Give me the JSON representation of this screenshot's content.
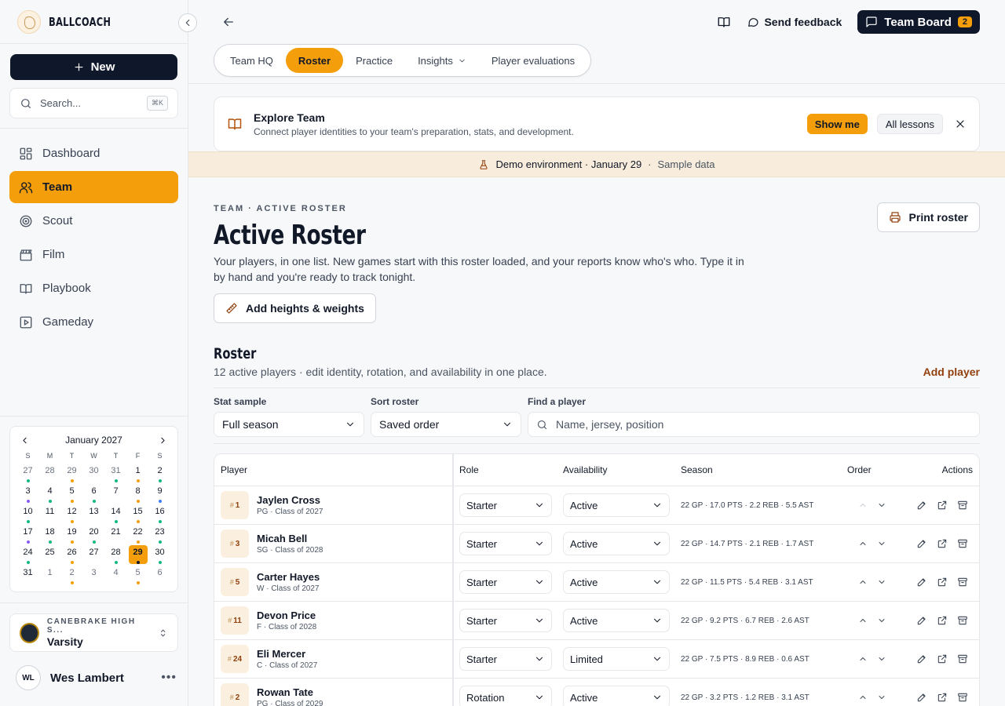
{
  "brand": {
    "name": "BALLCOACH"
  },
  "sidebar": {
    "new_label": "New",
    "search_placeholder": "Search...",
    "search_shortcut": "⌘K",
    "nav": [
      {
        "label": "Dashboard",
        "icon": "grid-icon"
      },
      {
        "label": "Team",
        "icon": "users-icon"
      },
      {
        "label": "Scout",
        "icon": "target-icon"
      },
      {
        "label": "Film",
        "icon": "clapper-icon"
      },
      {
        "label": "Playbook",
        "icon": "book-icon"
      },
      {
        "label": "Gameday",
        "icon": "play-icon"
      }
    ],
    "active_nav": "Team"
  },
  "calendar": {
    "month": "January 2027",
    "weekdays": [
      "S",
      "M",
      "T",
      "W",
      "T",
      "F",
      "S"
    ],
    "days": [
      {
        "d": "27",
        "muted": true,
        "dot": "#10b981"
      },
      {
        "d": "28",
        "muted": true
      },
      {
        "d": "29",
        "muted": true,
        "dot": "#f59e0b"
      },
      {
        "d": "30",
        "muted": true
      },
      {
        "d": "31",
        "muted": true,
        "dot": "#10b981"
      },
      {
        "d": "1",
        "dot": "#f59e0b"
      },
      {
        "d": "2",
        "dot": "#10b981"
      },
      {
        "d": "3",
        "dot": "#8b5cf6"
      },
      {
        "d": "4",
        "dot": "#10b981"
      },
      {
        "d": "5",
        "dot": "#f59e0b"
      },
      {
        "d": "6",
        "dot": "#10b981"
      },
      {
        "d": "7"
      },
      {
        "d": "8",
        "dot": "#f59e0b"
      },
      {
        "d": "9",
        "dot": "#3b82f6"
      },
      {
        "d": "10",
        "dot": "#10b981"
      },
      {
        "d": "11"
      },
      {
        "d": "12",
        "dot": "#f59e0b"
      },
      {
        "d": "13"
      },
      {
        "d": "14",
        "dot": "#10b981"
      },
      {
        "d": "15",
        "dot": "#f59e0b"
      },
      {
        "d": "16",
        "dot": "#10b981"
      },
      {
        "d": "17",
        "dot": "#8b5cf6"
      },
      {
        "d": "18",
        "dot": "#10b981"
      },
      {
        "d": "19",
        "dot": "#f59e0b"
      },
      {
        "d": "20",
        "dot": "#10b981"
      },
      {
        "d": "21"
      },
      {
        "d": "22",
        "dot": "#f59e0b"
      },
      {
        "d": "23",
        "dot": "#10b981"
      },
      {
        "d": "24",
        "dot": "#10b981"
      },
      {
        "d": "25"
      },
      {
        "d": "26",
        "dot": "#f59e0b"
      },
      {
        "d": "27"
      },
      {
        "d": "28",
        "dot": "#10b981"
      },
      {
        "d": "29",
        "today": true,
        "dot": "#111827"
      },
      {
        "d": "30",
        "dot": "#10b981"
      },
      {
        "d": "31"
      },
      {
        "d": "1",
        "muted": true
      },
      {
        "d": "2",
        "muted": true,
        "dot": "#f59e0b"
      },
      {
        "d": "3",
        "muted": true
      },
      {
        "d": "4",
        "muted": true
      },
      {
        "d": "5",
        "muted": true,
        "dot": "#f59e0b"
      },
      {
        "d": "6",
        "muted": true
      }
    ]
  },
  "team": {
    "school": "CANEBRAKE HIGH S...",
    "level": "Varsity"
  },
  "user": {
    "initials": "WL",
    "name": "Wes Lambert"
  },
  "topbar": {
    "send_feedback": "Send feedback",
    "team_board": "Team Board",
    "team_board_count": "2"
  },
  "tabs": [
    {
      "label": "Team HQ"
    },
    {
      "label": "Roster",
      "active": true
    },
    {
      "label": "Practice"
    },
    {
      "label": "Insights",
      "dropdown": true
    },
    {
      "label": "Player evaluations"
    }
  ],
  "lesson": {
    "title": "Explore Team",
    "subtitle": "Connect player identities to your team's preparation, stats, and development.",
    "show_me": "Show me",
    "all_lessons": "All lessons"
  },
  "demo": {
    "text": "Demo environment · January 29",
    "sep": "·",
    "sample": "Sample data"
  },
  "page": {
    "eyebrow": "TEAM · ACTIVE ROSTER",
    "title": "Active Roster",
    "description": "Your players, in one list. New games start with this roster loaded, and your reports know who's who. Type it in by hand and you're ready to track tonight.",
    "heights_button": "Add heights & weights",
    "print_button": "Print roster"
  },
  "roster": {
    "title": "Roster",
    "subtitle": "12 active players · edit identity, rotation, and availability in one place.",
    "add_player": "Add player",
    "filters": {
      "stat_label": "Stat sample",
      "stat_value": "Full season",
      "sort_label": "Sort roster",
      "sort_value": "Saved order",
      "find_label": "Find a player",
      "find_placeholder": "Name, jersey, position"
    },
    "columns": {
      "player": "Player",
      "role": "Role",
      "availability": "Availability",
      "season": "Season",
      "order": "Order",
      "actions": "Actions"
    },
    "players": [
      {
        "jersey": "1",
        "name": "Jaylen Cross",
        "meta": "PG · Class of 2027",
        "role": "Starter",
        "availability": "Active",
        "season": "22 GP · 17.0 PTS · 2.2 REB · 5.5 AST"
      },
      {
        "jersey": "3",
        "name": "Micah Bell",
        "meta": "SG · Class of 2028",
        "role": "Starter",
        "availability": "Active",
        "season": "22 GP · 14.7 PTS · 2.1 REB · 1.7 AST"
      },
      {
        "jersey": "5",
        "name": "Carter Hayes",
        "meta": "W · Class of 2027",
        "role": "Starter",
        "availability": "Active",
        "season": "22 GP · 11.5 PTS · 5.4 REB · 3.1 AST"
      },
      {
        "jersey": "11",
        "name": "Devon Price",
        "meta": "F · Class of 2028",
        "role": "Starter",
        "availability": "Active",
        "season": "22 GP · 9.2 PTS · 6.7 REB · 2.6 AST"
      },
      {
        "jersey": "24",
        "name": "Eli Mercer",
        "meta": "C · Class of 2027",
        "role": "Starter",
        "availability": "Limited",
        "season": "22 GP · 7.5 PTS · 8.9 REB · 0.6 AST"
      },
      {
        "jersey": "2",
        "name": "Rowan Tate",
        "meta": "PG · Class of 2029",
        "role": "Rotation",
        "availability": "Active",
        "season": "22 GP · 3.2 PTS · 1.2 REB · 3.1 AST"
      }
    ]
  }
}
